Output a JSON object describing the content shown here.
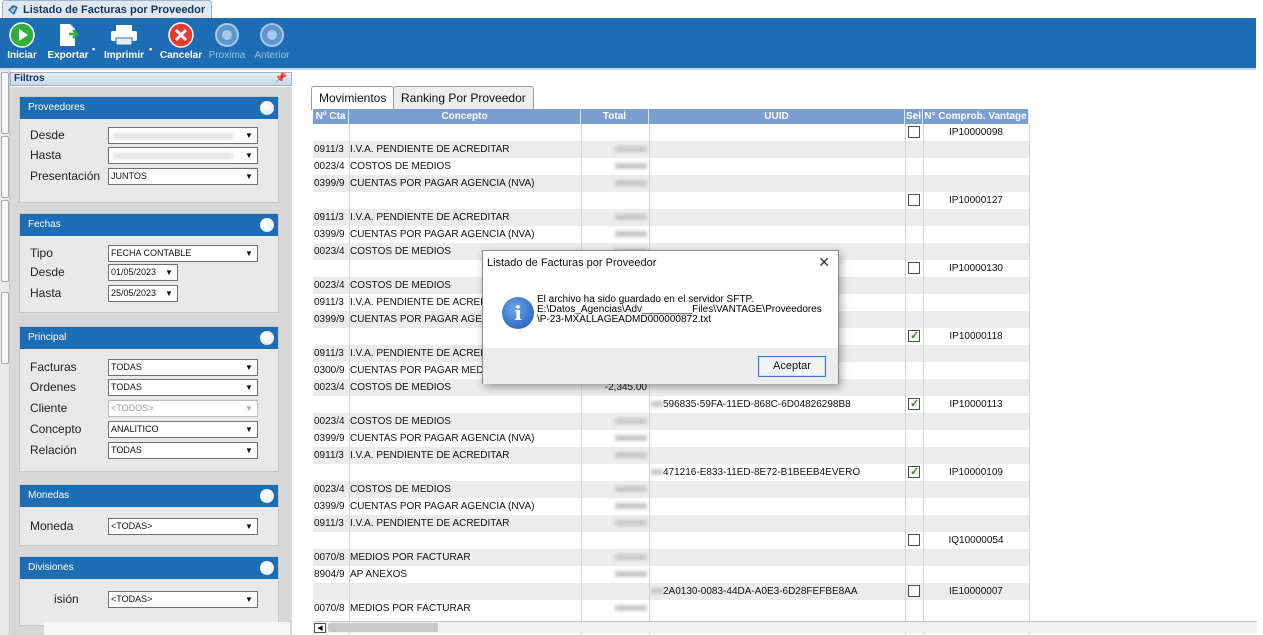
{
  "window": {
    "title": "Listado de Facturas por Proveedor"
  },
  "toolbar": {
    "buttons": [
      {
        "label": "Iniciar",
        "icon": "play-icon",
        "enabled": true
      },
      {
        "label": "Exportar",
        "icon": "export-icon",
        "enabled": true
      },
      {
        "label": "Imprimir",
        "icon": "print-icon",
        "enabled": true
      },
      {
        "label": "Cancelar",
        "icon": "cancel-icon",
        "enabled": true
      },
      {
        "label": "Proxima",
        "icon": "next-icon",
        "enabled": false
      },
      {
        "label": "Anterior",
        "icon": "previous-icon",
        "enabled": false
      }
    ]
  },
  "filters": {
    "title": "Filtros",
    "groups": {
      "proveedores": {
        "title": "Proveedores",
        "desde_label": "Desde",
        "hasta_label": "Hasta",
        "presentacion_label": "Presentación",
        "presentacion_value": "JUNTOS"
      },
      "fechas": {
        "title": "Fechas",
        "tipo_label": "Tipo",
        "tipo_value": "FECHA CONTABLE",
        "desde_label": "Desde",
        "desde_value": "01/05/2023",
        "hasta_label": "Hasta",
        "hasta_value": "25/05/2023"
      },
      "principal": {
        "title": "Principal",
        "facturas_label": "Facturas",
        "facturas_value": "TODAS",
        "ordenes_label": "Ordenes",
        "ordenes_value": "TODAS",
        "cliente_label": "Cliente",
        "cliente_value": "<TODOS>",
        "concepto_label": "Concepto",
        "concepto_value": "ANALITICO",
        "relacion_label": "Relación",
        "relacion_value": "TODAS"
      },
      "monedas": {
        "title": "Monedas",
        "moneda_label": "Moneda",
        "moneda_value": "<TODAS>"
      },
      "divisiones": {
        "title": "Divisiones",
        "division_label": "isión",
        "division_value": "<TODAS>"
      }
    }
  },
  "tabs": [
    {
      "label": "Movimientos",
      "active": true
    },
    {
      "label": "Ranking Por Proveedor",
      "active": false
    }
  ],
  "grid": {
    "headers": [
      "Nº Cta",
      "Concepto",
      "Total",
      "UUID",
      "Sel",
      "N° Comprob. Vantage"
    ],
    "rows": [
      {
        "cta": "",
        "concepto": "",
        "total": "",
        "uuid": "",
        "sel": false,
        "comp": "IP10000098"
      },
      {
        "cta": "0911/3",
        "concepto": "I.V.A. PENDIENTE DE ACREDITAR",
        "total": "",
        "uuid": "",
        "comp": ""
      },
      {
        "cta": "0023/4",
        "concepto": "COSTOS DE MEDIOS",
        "total": "",
        "uuid": "",
        "comp": ""
      },
      {
        "cta": "0399/9",
        "concepto": "CUENTAS POR PAGAR AGENCIA (NVA)",
        "total": "",
        "uuid": "",
        "comp": ""
      },
      {
        "cta": "",
        "concepto": "",
        "total": "",
        "uuid": "",
        "sel": false,
        "comp": "IP10000127"
      },
      {
        "cta": "0911/3",
        "concepto": "I.V.A. PENDIENTE DE ACREDITAR",
        "total": "",
        "uuid": "",
        "comp": ""
      },
      {
        "cta": "0399/9",
        "concepto": "CUENTAS POR PAGAR AGENCIA (NVA)",
        "total": "",
        "uuid": "",
        "comp": ""
      },
      {
        "cta": "0023/4",
        "concepto": "COSTOS DE MEDIOS",
        "total": "",
        "uuid": "",
        "comp": ""
      },
      {
        "cta": "",
        "concepto": "",
        "total": "",
        "uuid": "",
        "sel": false,
        "comp": "IP10000130"
      },
      {
        "cta": "0023/4",
        "concepto": "COSTOS DE MEDIOS",
        "total": "",
        "uuid": "",
        "comp": ""
      },
      {
        "cta": "0911/3",
        "concepto": "I.V.A. PENDIENTE DE ACREDITAR",
        "total": "",
        "uuid": "",
        "comp": ""
      },
      {
        "cta": "0399/9",
        "concepto": "CUENTAS POR PAGAR AGENCIA (NVA)",
        "total": "",
        "uuid": "",
        "comp": ""
      },
      {
        "cta": "",
        "concepto": "",
        "total": "",
        "uuid": "",
        "sel": true,
        "comp": "IP10000118"
      },
      {
        "cta": "0911/3",
        "concepto": "I.V.A. PENDIENTE DE ACREDITAR",
        "total": "",
        "uuid": "",
        "comp": ""
      },
      {
        "cta": "0300/9",
        "concepto": "CUENTAS POR PAGAR MEDIOS",
        "total": "",
        "uuid": "",
        "comp": ""
      },
      {
        "cta": "0023/4",
        "concepto": "COSTOS DE MEDIOS",
        "total": "-2,345.00",
        "uuid": "",
        "comp": ""
      },
      {
        "cta": "",
        "concepto": "",
        "total": "",
        "uuid": "596835-59FA-11ED-868C-6D04826298B8",
        "sel": true,
        "comp": "IP10000113"
      },
      {
        "cta": "0023/4",
        "concepto": "COSTOS DE MEDIOS",
        "total": "",
        "uuid": "",
        "comp": ""
      },
      {
        "cta": "0399/9",
        "concepto": "CUENTAS POR PAGAR AGENCIA (NVA)",
        "total": "",
        "uuid": "",
        "comp": ""
      },
      {
        "cta": "0911/3",
        "concepto": "I.V.A. PENDIENTE DE ACREDITAR",
        "total": "",
        "uuid": "",
        "comp": ""
      },
      {
        "cta": "",
        "concepto": "",
        "total": "",
        "uuid": "471216-E833-11ED-8E72-B1BEEB4EVERO",
        "sel": true,
        "comp": "IP10000109"
      },
      {
        "cta": "0023/4",
        "concepto": "COSTOS DE MEDIOS",
        "total": "",
        "uuid": "",
        "comp": ""
      },
      {
        "cta": "0399/9",
        "concepto": "CUENTAS POR PAGAR AGENCIA (NVA)",
        "total": "",
        "uuid": "",
        "comp": ""
      },
      {
        "cta": "0911/3",
        "concepto": "I.V.A. PENDIENTE DE ACREDITAR",
        "total": "",
        "uuid": "",
        "comp": ""
      },
      {
        "cta": "",
        "concepto": "",
        "total": "",
        "uuid": "",
        "sel": false,
        "comp": "IQ10000054"
      },
      {
        "cta": "0070/8",
        "concepto": "MEDIOS POR FACTURAR",
        "total": "",
        "uuid": "",
        "comp": ""
      },
      {
        "cta": "8904/9",
        "concepto": "AP ANEXOS",
        "total": "",
        "uuid": "",
        "comp": ""
      },
      {
        "cta": "",
        "concepto": "",
        "total": "",
        "uuid": "2A0130-0083-44DA-A0E3-6D28FEFBE8AA",
        "sel": false,
        "comp": "IE10000007"
      },
      {
        "cta": "0070/8",
        "concepto": "MEDIOS POR FACTURAR",
        "total": "",
        "uuid": "",
        "comp": ""
      }
    ]
  },
  "dialog": {
    "title": "Listado de Facturas por Proveedor",
    "message_line1": "El archivo ha sido guardado en el servidor SFTP.",
    "message_line2": "E:\\Datos_Agencias\\Adv_________Files\\VANTAGE\\Proveedores",
    "message_line3": "\\P-23-MXALLAGEADMD000000872.txt",
    "ok_label": "Aceptar",
    "icon": "info-icon"
  }
}
